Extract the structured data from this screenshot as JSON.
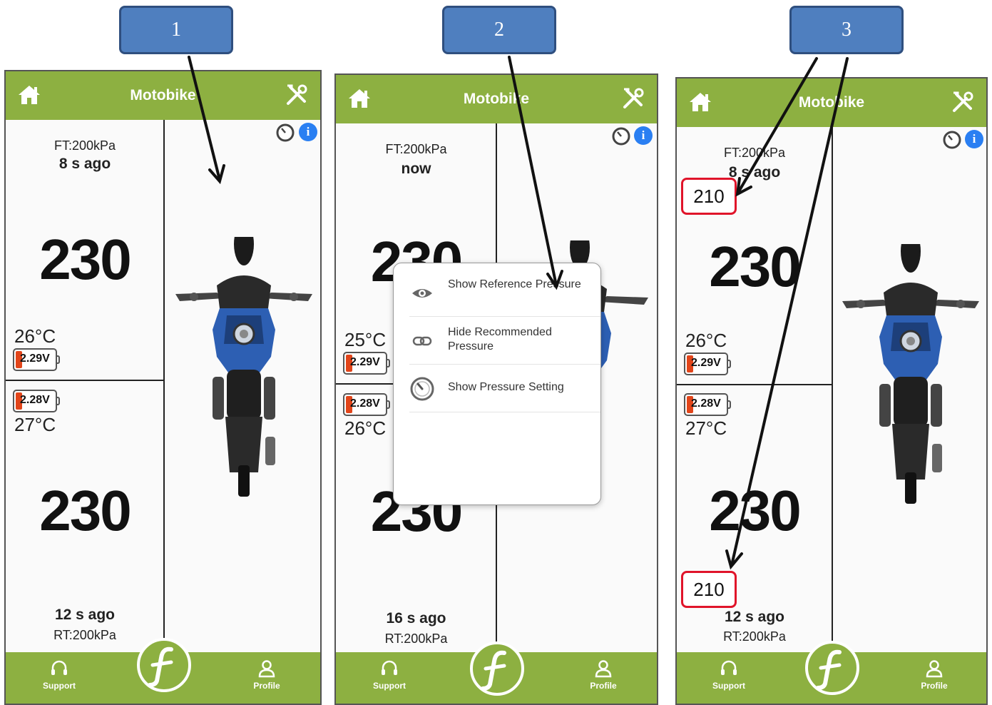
{
  "callouts": [
    "1",
    "2",
    "3"
  ],
  "app": {
    "title": "Motobike",
    "footer": {
      "support": "Support",
      "profile": "Profile"
    },
    "icons": {
      "home": "home-icon",
      "tools": "tools-icon",
      "gauge": "gauge-icon",
      "info": "info-icon",
      "logo": "f-logo-icon"
    },
    "colors": {
      "header": "#8db041",
      "battery_low": "#e2451a",
      "highlight": "#e0142a",
      "info": "#2a7ff2",
      "callout": "#4f7fbf"
    }
  },
  "panels": [
    {
      "front": {
        "label": "FT:200kPa",
        "ago": "8 s ago",
        "pressure": "230",
        "temp": "26°C",
        "battery": "2.29V"
      },
      "rear": {
        "label": "RT:200kPa",
        "ago": "12 s ago",
        "pressure": "230",
        "temp": "27°C",
        "battery": "2.28V"
      }
    },
    {
      "front": {
        "label": "FT:200kPa",
        "ago": "now",
        "pressure": "230",
        "temp": "25°C",
        "battery": "2.29V"
      },
      "rear": {
        "label": "RT:200kPa",
        "ago": "16 s ago",
        "pressure": "230",
        "temp": "26°C",
        "battery": "2.28V"
      },
      "menu": [
        {
          "label": "Show Reference Pressure",
          "icon": "eye-icon"
        },
        {
          "label": "Hide Recommended Pressure",
          "icon": "link-icon"
        },
        {
          "label": "Show Pressure Setting",
          "icon": "gauge-icon"
        }
      ]
    },
    {
      "front": {
        "label": "FT:200kPa",
        "ago": "8 s ago",
        "pressure": "230",
        "temp": "26°C",
        "battery": "2.29V",
        "reference": "210"
      },
      "rear": {
        "label": "RT:200kPa",
        "ago": "12 s ago",
        "pressure": "230",
        "temp": "27°C",
        "battery": "2.28V",
        "reference": "210"
      }
    }
  ]
}
